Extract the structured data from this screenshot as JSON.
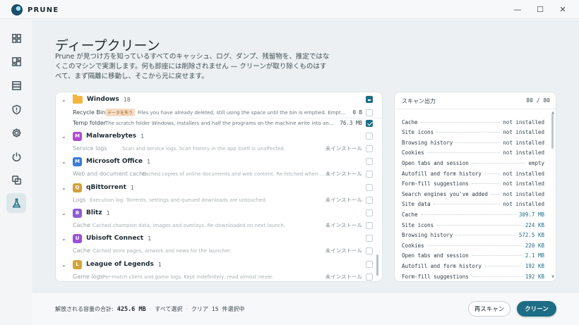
{
  "app": {
    "name": "PRUNE"
  },
  "window": {
    "minimize": "—",
    "maximize": "☐",
    "close": "✕"
  },
  "sidebar": {
    "items": [
      {
        "name": "dashboard",
        "icon": "grid-icon"
      },
      {
        "name": "apps",
        "icon": "apps-icon"
      },
      {
        "name": "storage",
        "icon": "storage-icon"
      },
      {
        "name": "privacy",
        "icon": "shield-alert-icon"
      },
      {
        "name": "settings",
        "icon": "gear-icon"
      },
      {
        "name": "startup",
        "icon": "power-icon"
      },
      {
        "name": "duplicates",
        "icon": "copy-icon"
      },
      {
        "name": "deep-clean",
        "icon": "flask-icon",
        "active": true
      }
    ]
  },
  "page": {
    "title": "ディープクリーン",
    "description": "Prune が見つけ方を知っているすべてのキャッシュ、ログ、ダンプ、残留物を、推定ではなくこのマシンで実測します。何も即座には削除されません — クリーンが取り除くものはすべて、まず隔離に移動し、そこから元に戻せます。"
  },
  "groups": [
    {
      "name": "Windows",
      "count": "18",
      "icon_type": "folder",
      "expanded": true,
      "check": "mixed",
      "items": [
        {
          "name": "Recycle Bin",
          "badge": "データを失う",
          "desc": "Files you have already deleted, still using the space until the bin is emptied. Emptying it is the...",
          "size": "0 B",
          "checked": false
        },
        {
          "name": "Temp folder",
          "desc": "The scratch folder Windows, installers and half the programs on the machine write into and rarely clea...",
          "size": "76.3 MB",
          "checked": true
        }
      ]
    },
    {
      "name": "Malwarebytes",
      "count": "1",
      "letter": "M",
      "color": "#b04ad0",
      "check": "off",
      "items": [
        {
          "name": "Service logs",
          "desc": "Scan and service logs. Scan history in the app itself is unaffected.",
          "status": "未インストール",
          "dim": true
        }
      ]
    },
    {
      "name": "Microsoft Office",
      "count": "1",
      "letter": "M",
      "color": "#3a7bd5",
      "check": "off",
      "items": [
        {
          "name": "Web and document cache",
          "desc": "Cached copies of online documents and web content. Re-fetched when reopene...",
          "status": "未インストール",
          "dim": true
        }
      ]
    },
    {
      "name": "qBittorrent",
      "count": "1",
      "letter": "Q",
      "color": "#d0a23a",
      "check": "off",
      "items": [
        {
          "name": "Logs",
          "desc": "Execution log. Torrents, settings and queued downloads are untouched.",
          "status": "未インストール",
          "dim": true
        }
      ]
    },
    {
      "name": "Blitz",
      "count": "1",
      "letter": "B",
      "color": "#8e5ad8",
      "check": "off",
      "items": [
        {
          "name": "Cache",
          "desc": "Cached champion data, images and overlays. Re-downloaded on next launch.",
          "status": "未インストール",
          "dim": true
        }
      ]
    },
    {
      "name": "Ubisoft Connect",
      "count": "1",
      "letter": "U",
      "color": "#9b4fd6",
      "check": "off",
      "items": [
        {
          "name": "Cache",
          "desc": "Cached store pages, artwork and news for the launcher.",
          "status": "未インストール",
          "dim": true
        }
      ]
    },
    {
      "name": "League of Legends",
      "count": "1",
      "letter": "L",
      "color": "#d4a33a",
      "check": "off",
      "items": [
        {
          "name": "Game logs",
          "desc": "Per-match client and game logs. Kept indefinitely, read almost never.",
          "status": "未インストール",
          "dim": true
        }
      ]
    }
  ],
  "scan": {
    "title": "スキャン出力",
    "count": "80 / 80",
    "lines": [
      {
        "label": "Cache",
        "value": "not installed"
      },
      {
        "label": "Site icons",
        "value": "not installed"
      },
      {
        "label": "Browsing history",
        "value": "not installed"
      },
      {
        "label": "Cookies",
        "value": "not installed"
      },
      {
        "label": "Open tabs and session",
        "value": "empty"
      },
      {
        "label": "Autofill and form history",
        "value": "not installed"
      },
      {
        "label": "Form-fill suggestions",
        "value": "not installed"
      },
      {
        "label": "Search engines you've added",
        "value": "not installed"
      },
      {
        "label": "Site data",
        "value": "not installed"
      },
      {
        "label": "Cache",
        "value": "309.7 MB",
        "highlight": true
      },
      {
        "label": "Site icons",
        "value": "224 KB",
        "highlight": true
      },
      {
        "label": "Browsing history",
        "value": "572.5 KB",
        "highlight": true
      },
      {
        "label": "Cookies",
        "value": "220 KB",
        "highlight": true
      },
      {
        "label": "Open tabs and session",
        "value": "2.1 MB",
        "highlight": true
      },
      {
        "label": "Autofill and form history",
        "value": "192 KB",
        "highlight": true
      },
      {
        "label": "Form-fill suggestions",
        "value": "192 KB",
        "highlight": true
      }
    ]
  },
  "footer": {
    "total_label": "解放される容量の合計:",
    "total_value": "425.6 MB",
    "select_all": "すべて選択",
    "clear": "クリア",
    "selected_count": "15",
    "selected_suffix": "件選択中",
    "rescan": "再スキャン",
    "clean": "クリーン"
  },
  "colors": {
    "accent": "#1d6d86",
    "badge_bg": "#f5dcc4",
    "folder": "#f2b640"
  }
}
